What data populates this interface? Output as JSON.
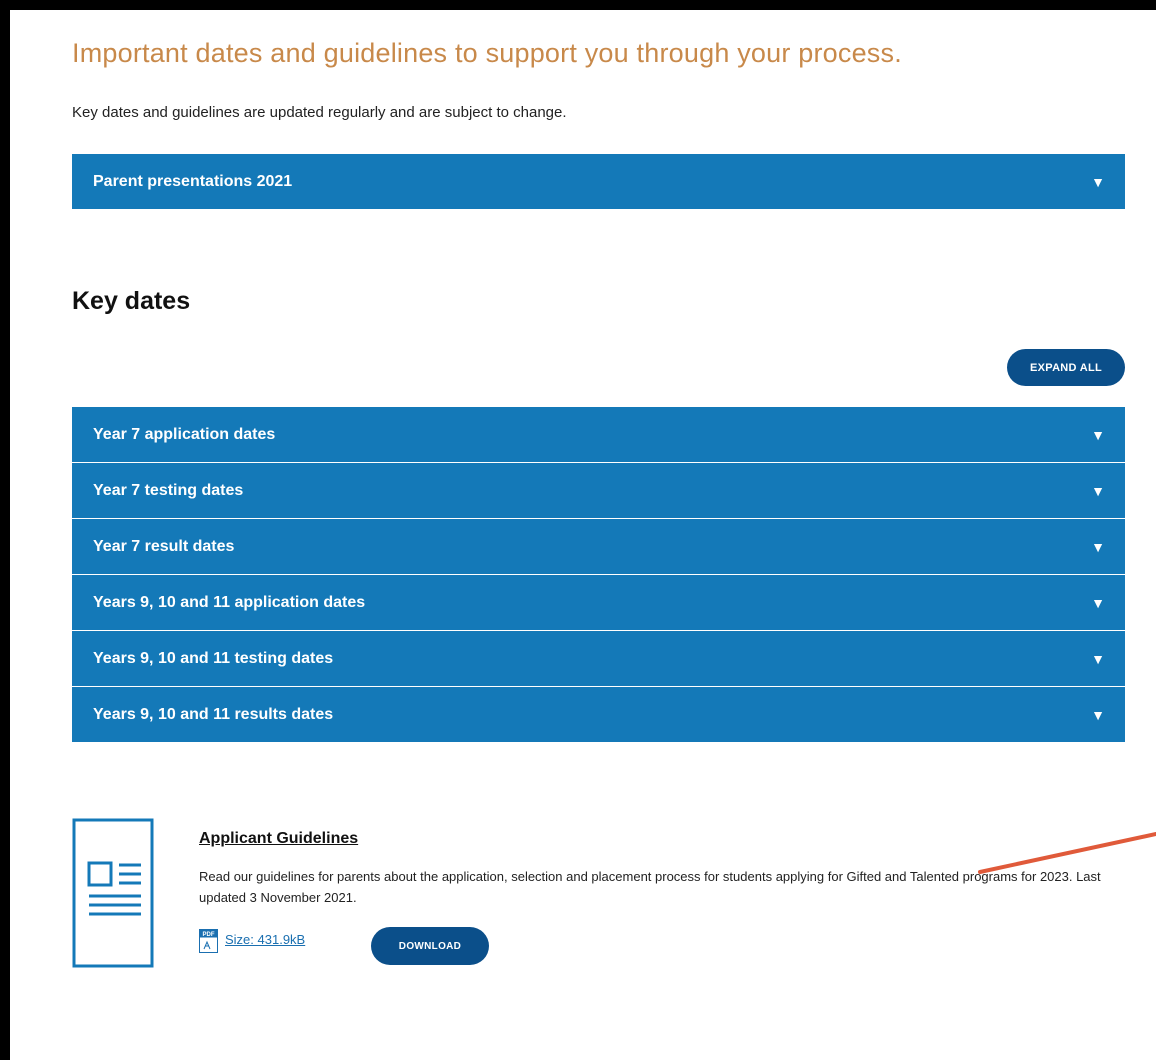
{
  "intro": {
    "title": "Important dates and guidelines to support you through your process.",
    "text": "Key dates and guidelines are updated regularly and are subject to change."
  },
  "parent_presentations": {
    "label": "Parent presentations 2021",
    "caret": "▼"
  },
  "key_dates": {
    "title": "Key dates",
    "expand_all": "EXPAND ALL",
    "items": [
      {
        "label": "Year 7 application dates",
        "caret": "▼"
      },
      {
        "label": "Year 7 testing dates",
        "caret": "▼"
      },
      {
        "label": "Year 7 result dates",
        "caret": "▼"
      },
      {
        "label": "Years 9, 10 and 11 application dates",
        "caret": "▼"
      },
      {
        "label": "Years 9, 10 and 11 testing dates",
        "caret": "▼"
      },
      {
        "label": "Years 9, 10 and 11 results dates",
        "caret": "▼"
      }
    ]
  },
  "document": {
    "title": "Applicant Guidelines",
    "description": "Read our guidelines for parents about the application, selection and placement process for students applying for Gifted and Talented programs for 2023. Last updated 3 November 2021.",
    "size": "Size: 431.9kB",
    "download": "DOWNLOAD",
    "pdf_icon_text": "PDF"
  },
  "colors": {
    "accent_title": "#c8894a",
    "accordion": "#1479b8",
    "button": "#0b4f8a",
    "link": "#1a6fb0",
    "annotation": "#e05a3a"
  }
}
